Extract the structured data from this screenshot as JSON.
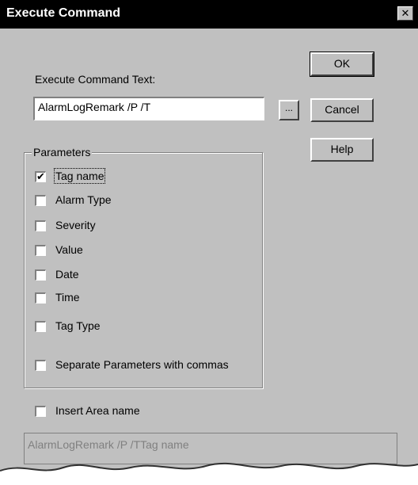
{
  "window": {
    "title": "Execute Command",
    "close_glyph": "✕"
  },
  "command_text": {
    "label": "Execute Command Text:",
    "value": "AlarmLogRemark /P /T",
    "browse_label": "..."
  },
  "buttons": {
    "ok": "OK",
    "cancel": "Cancel",
    "help": "Help"
  },
  "parameters": {
    "title": "Parameters",
    "items": [
      {
        "label": "Tag name",
        "checked": true
      },
      {
        "label": "Alarm Type",
        "checked": false
      },
      {
        "label": "Severity",
        "checked": false
      },
      {
        "label": "Value",
        "checked": false
      },
      {
        "label": "Date",
        "checked": false
      },
      {
        "label": "Time",
        "checked": false
      },
      {
        "label": "Tag Type",
        "checked": false
      },
      {
        "label": "Separate Parameters with commas",
        "checked": false
      }
    ]
  },
  "insert_area": {
    "label": "Insert Area name",
    "checked": false
  },
  "preview": {
    "value": "AlarmLogRemark /P /TTag name"
  }
}
